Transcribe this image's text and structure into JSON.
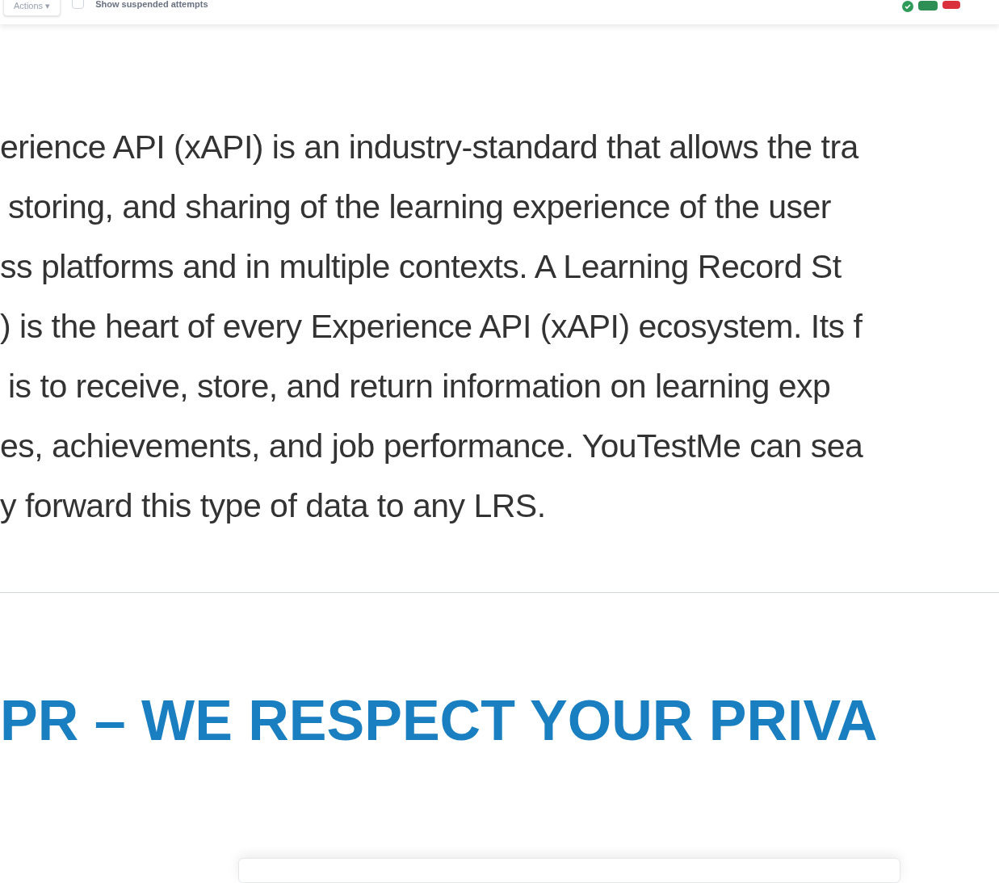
{
  "toolbar": {
    "actions_button": "Actions ▾",
    "show_suspended": {
      "label": "Show suspended attempts",
      "checked": false
    }
  },
  "paragraph_lines": [
    "erience API (xAPI) is an industry-standard that allows the tra",
    "storing, and sharing of the learning experience of the user",
    "ss platforms and in multiple contexts. A Learning Record St",
    ") is the heart of every Experience API (xAPI) ecosystem. Its f",
    "is to receive, store, and return information on learning exp",
    "es, achievements, and job performance. YouTestMe can sea",
    "y forward this type of data to any LRS."
  ],
  "heading": "PR – WE RESPECT YOUR PRIVA"
}
